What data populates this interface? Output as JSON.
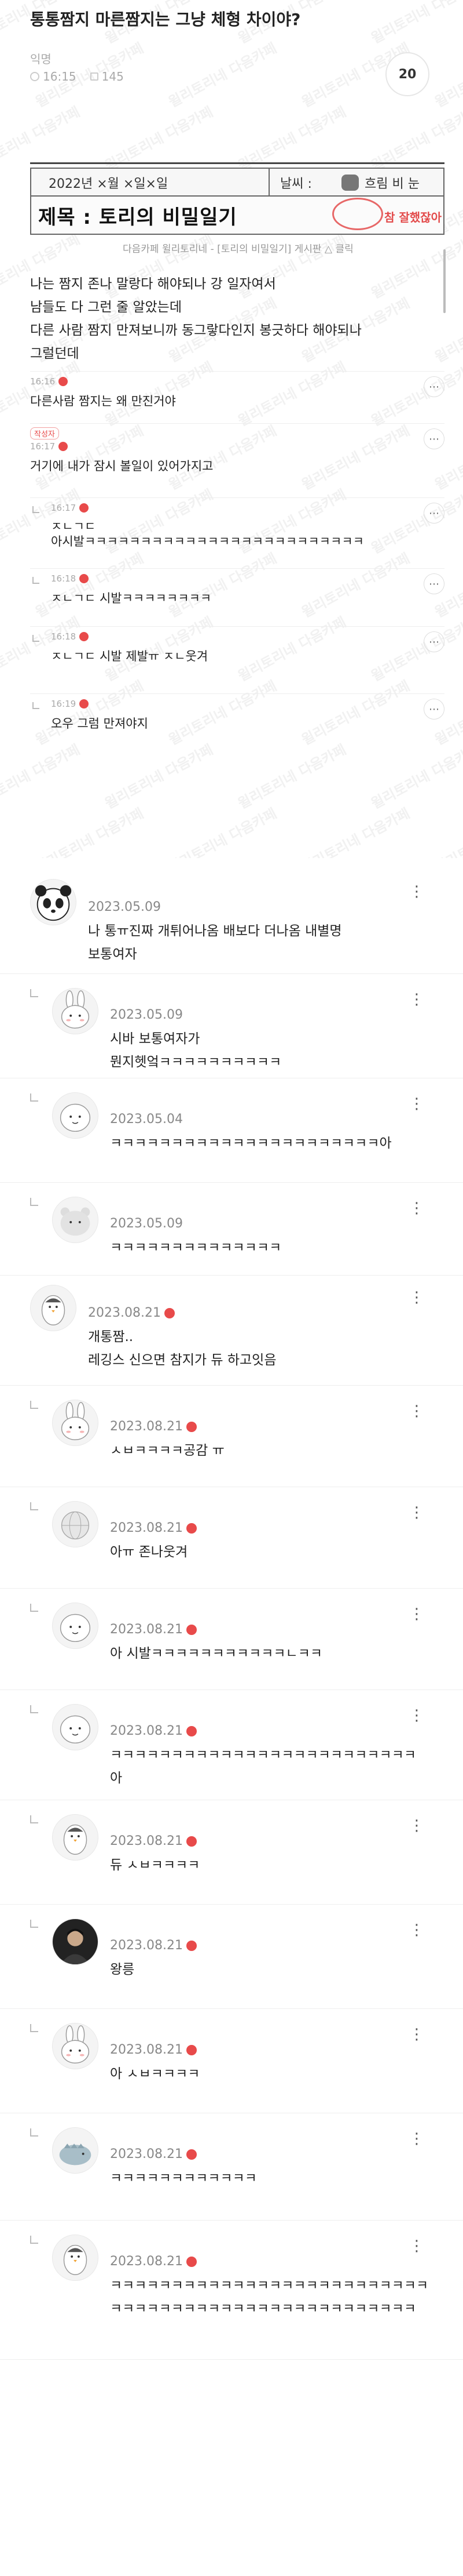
{
  "post": {
    "title": "통통짬지 마른짬지는 그냥 체형 차이야?",
    "author": "익명",
    "time": "16:15",
    "views": "145",
    "comment_count": "20"
  },
  "diary": {
    "date": "2022년 ×월 ×일×일",
    "weather_label": "날씨 :",
    "weather": "흐림 비 눈",
    "title": "제목 : 토리의 비밀일기",
    "stamp": "참 잘했잖아",
    "caption": "다음카페 윌리토리네 - [토리의 비밀일기] 게시판 △ 클릭"
  },
  "body": {
    "lines": [
      "나는 짬지 존나 말랑다 해야되나 강 일자여서",
      "남들도 다 그런 줄 알았는데",
      "다른 사람 짬지 만져보니까 동그랗다인지 봉긋하다 해야되나",
      "그럴던데"
    ]
  },
  "screenshot_comments": [
    {
      "time": "16:16",
      "text": "다른사람 짬지는 왜 만진거야",
      "writer": ""
    },
    {
      "time": "16:17",
      "text": "거기에 내가 잠시 볼일이 있어가지고",
      "writer": "작성자"
    },
    {
      "time": "16:17",
      "text": "ㅈㄴㄱㄷ\n아시발ㅋㅋㅋㅋㅋㅋㅋㅋㅋㅋㅋㅋㅋㅋㅋㅋㅋㅋㅋㅋㅋㅋㅋㅋㅋ",
      "writer": ""
    },
    {
      "time": "16:18",
      "text": "ㅈㄴㄱㄷ 시발ㅋㅋㅋㅋㅋㅋㅋㅋ",
      "writer": ""
    },
    {
      "time": "16:18",
      "text": "ㅈㄴㄱㄷ 시발 제발ㅠ ㅈㄴ웃겨",
      "writer": ""
    },
    {
      "time": "16:19",
      "text": "오우 그럼 만져야지",
      "writer": ""
    }
  ],
  "comments": [
    {
      "name": "",
      "date": "2023.05.09",
      "text": "나 통ㅠ진짜 개튀어나옴 배보다 더나옴 내별명\n보통여자",
      "reply": false,
      "dot": false,
      "avatar": "panda"
    },
    {
      "name": "",
      "date": "2023.05.09",
      "text": "시바 보통여자가\n뭔지헷엌ㅋㅋㅋㅋㅋㅋㅋㅋㅋㅋ",
      "reply": true,
      "dot": false,
      "avatar": "bunny"
    },
    {
      "name": "",
      "date": "2023.05.04",
      "text": "ㅋㅋㅋㅋㅋㅋㅋㅋㅋㅋㅋㅋㅋㅋㅋㅋㅋㅋㅋㅋㅋㅋ아",
      "reply": true,
      "dot": false,
      "avatar": "blob"
    },
    {
      "name": "",
      "date": "2023.05.09",
      "text": "ㅋㅋㅋㅋㅋㅋㅋㅋㅋㅋㅋㅋㅋㅋ",
      "reply": true,
      "dot": false,
      "avatar": "bear"
    },
    {
      "name": "",
      "date": "2023.08.21",
      "text": "개통짬..\n레깅스 신으면 참지가 듀 하고잇음",
      "reply": false,
      "dot": true,
      "avatar": "penguin"
    },
    {
      "name": "",
      "date": "2023.08.21",
      "text": "ㅅㅂㅋㅋㅋㅋ공감 ㅠ",
      "reply": true,
      "dot": true,
      "avatar": "bunny"
    },
    {
      "name": "",
      "date": "2023.08.21",
      "text": "아ㅠ 존나웃겨",
      "reply": true,
      "dot": true,
      "avatar": "globe"
    },
    {
      "name": "",
      "date": "2023.08.21",
      "text": "아 시발ㅋㅋㅋㅋㅋㅋㅋㅋㅋㅋㅋㄴㅋㅋ",
      "reply": true,
      "dot": true,
      "avatar": "blob"
    },
    {
      "name": "",
      "date": "2023.08.21",
      "text": "ㅋㅋㅋㅋㅋㅋㅋㅋㅋㅋㅋㅋㅋㅋㅋㅋㅋㅋㅋㅋㅋㅋㅋㅋㅋ\n아",
      "reply": true,
      "dot": true,
      "avatar": "blob"
    },
    {
      "name": "",
      "date": "2023.08.21",
      "text": "듀 ㅅㅂㅋㅋㅋㅋ",
      "reply": true,
      "dot": true,
      "avatar": "penguin"
    },
    {
      "name": "",
      "date": "2023.08.21",
      "text": "왕릉",
      "reply": true,
      "dot": true,
      "avatar": "photo"
    },
    {
      "name": "",
      "date": "2023.08.21",
      "text": "아 ㅅㅂㅋㅋㅋㅋ",
      "reply": true,
      "dot": true,
      "avatar": "bunny"
    },
    {
      "name": "",
      "date": "2023.08.21",
      "text": "ㅋㅋㅋㅋㅋㅋㅋㅋㅋㅋㅋㅋ",
      "reply": true,
      "dot": true,
      "avatar": "dino"
    },
    {
      "name": "",
      "date": "2023.08.21",
      "text": "ㅋㅋㅋㅋㅋㅋㅋㅋㅋㅋㅋㅋㅋㅋㅋㅋㅋㅋㅋㅋㅋㅋㅋㅋㅋㅋ\nㅋㅋㅋㅋㅋㅋㅋㅋㅋㅋㅋㅋㅋㅋㅋㅋㅋㅋㅋㅋㅋㅋㅋㅋㅋ",
      "reply": true,
      "dot": true,
      "avatar": "penguin"
    }
  ]
}
